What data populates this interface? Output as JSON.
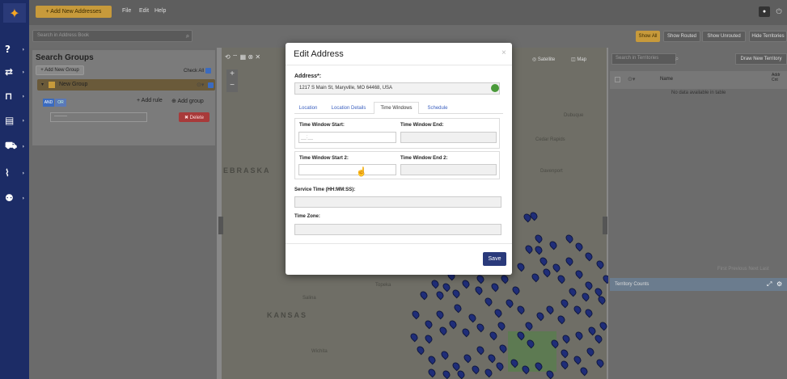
{
  "topbar": {
    "add_button": "+ Add New Addresses",
    "menus": [
      "File",
      "Edit",
      "Help"
    ]
  },
  "subbar": {
    "search_placeholder": "Search in Address Book",
    "filters": [
      "Show All",
      "Show Routed",
      "Show Unrouted",
      "Hide Territories"
    ]
  },
  "left_panel": {
    "title": "Search Groups",
    "add_group": "+ Add New Group",
    "check_all": "Check All",
    "group_name": "New Group",
    "and_label": "AND",
    "or_label": "OR",
    "add_rule": "+ Add rule",
    "add_group_btn": "Add group",
    "rule_select": "--------",
    "delete_label": "✖ Delete"
  },
  "map": {
    "satellite": "Satellite",
    "map_label": "Map",
    "state_labels": [
      "EBRASKA",
      "KANSAS"
    ],
    "towns": [
      "Topeka",
      "Wichita",
      "Salina",
      "Cedar Rapids",
      "Davenport",
      "Dubuque"
    ]
  },
  "right_panel": {
    "search_placeholder": "Search in Territories",
    "draw_territory": "Draw New Territory",
    "name_col": "Name",
    "cnt_col": "Addr\nCnt",
    "no_data": "No data available in table",
    "pagination": "First  Previous  Next  Last",
    "territory_counts": "Territory Counts"
  },
  "modal": {
    "title": "Edit Address",
    "close": "×",
    "address_label": "Address*:",
    "address_value": "1217 S Main St, Maryville, MO 64468, USA",
    "tabs": [
      "Location",
      "Location Details",
      "Time Windows",
      "Schedule"
    ],
    "tw_start": "Time Window Start:",
    "tw_end": "Time Window End:",
    "tw_start_value": "__:__",
    "tw_start2": "Time Window Start 2:",
    "tw_end2": "Time Window End 2:",
    "service_time": "Service Time (HH:MM:SS):",
    "time_zone": "Time Zone:",
    "save": "Save"
  }
}
